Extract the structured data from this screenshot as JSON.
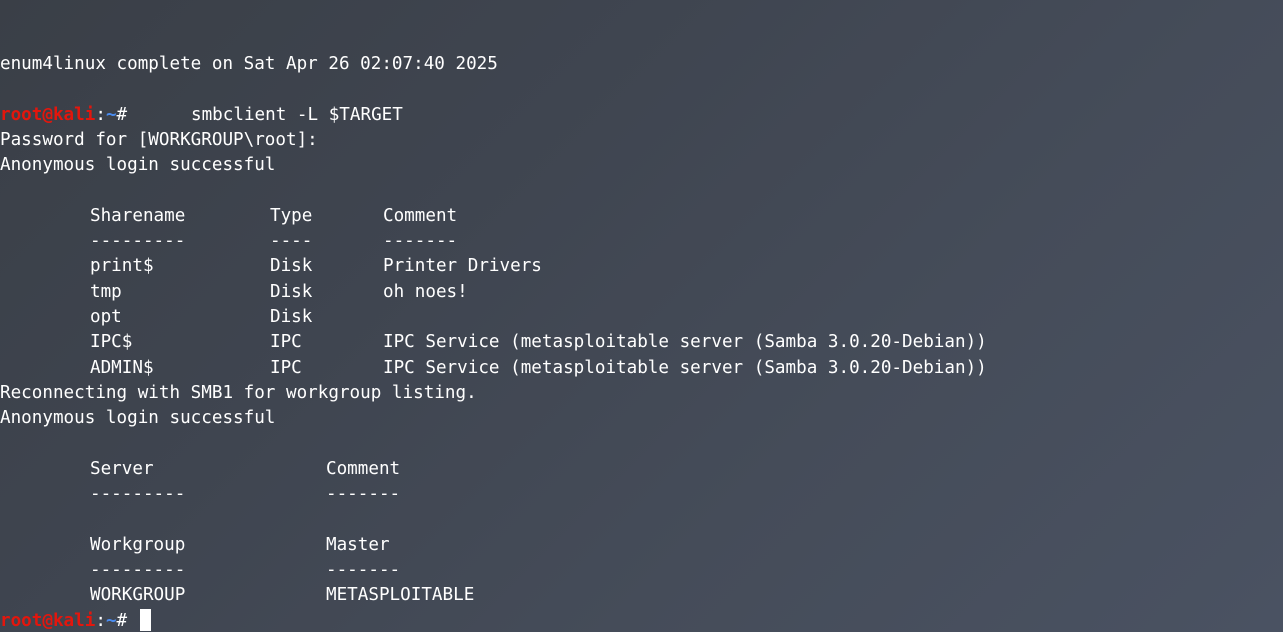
{
  "colors": {
    "prompt_user": "#e3160d",
    "prompt_path": "#4a8cf0",
    "text": "#ffffff",
    "background": "#3f4550"
  },
  "terminal": {
    "completion_line": "enum4linux complete on Sat Apr 26 02:07:40 2025",
    "prompt": {
      "user_host": "root@kali",
      "separator": ":",
      "path": "~",
      "symbol": "#"
    },
    "command": "smbclient -L $TARGET",
    "password_prompt": "Password for [WORKGROUP\\root]:",
    "anon_login_1": "Anonymous login successful",
    "share_table": {
      "headers": [
        "Sharename",
        "Type",
        "Comment"
      ],
      "underlines": [
        "---------",
        "----",
        "-------"
      ],
      "rows": [
        [
          "print$",
          "Disk",
          "Printer Drivers"
        ],
        [
          "tmp",
          "Disk",
          "oh noes!"
        ],
        [
          "opt",
          "Disk",
          ""
        ],
        [
          "IPC$",
          "IPC",
          "IPC Service (metasploitable server (Samba 3.0.20-Debian))"
        ],
        [
          "ADMIN$",
          "IPC",
          "IPC Service (metasploitable server (Samba 3.0.20-Debian))"
        ]
      ]
    },
    "reconnect_line": "Reconnecting with SMB1 for workgroup listing.",
    "anon_login_2": "Anonymous login successful",
    "server_table": {
      "headers": [
        "Server",
        "Comment"
      ],
      "underlines": [
        "---------",
        "-------"
      ]
    },
    "workgroup_table": {
      "headers": [
        "Workgroup",
        "Master"
      ],
      "underlines": [
        "---------",
        "-------"
      ],
      "rows": [
        [
          "WORKGROUP",
          "METASPLOITABLE"
        ]
      ]
    }
  }
}
